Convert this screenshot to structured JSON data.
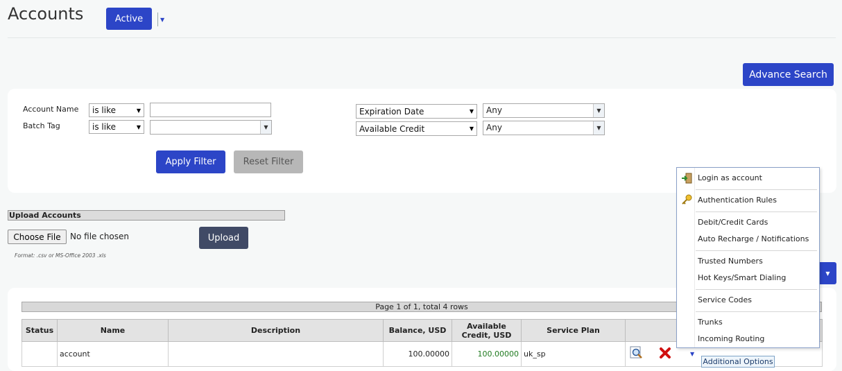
{
  "header": {
    "title": "Accounts",
    "status_button": "Active",
    "caret_glyph": "▼",
    "advance_search": "Advance Search"
  },
  "filter": {
    "account_name_label": "Account Name",
    "batch_tag_label": "Batch Tag",
    "account_name_op": "is like",
    "batch_tag_op": "is like",
    "account_name_value": "",
    "batch_tag_value": "",
    "expiration_field": "Expiration Date",
    "expiration_value": "Any",
    "credit_field": "Available Credit",
    "credit_value": "Any",
    "apply": "Apply Filter",
    "reset": "Reset Filter"
  },
  "upload": {
    "header": "Upload Accounts",
    "choose_file": "Choose File",
    "no_file": "No file chosen",
    "upload": "Upload",
    "format_note": "Format: .csv or MS-Office 2003 .xls"
  },
  "table": {
    "pager": "Page 1 of 1, total 4 rows",
    "columns": [
      "Status",
      "Name",
      "Description",
      "Balance, USD",
      "Available Credit, USD",
      "Service Plan",
      ""
    ],
    "rows": [
      {
        "status": "",
        "name": "account",
        "description": "",
        "balance": "100.00000",
        "available_credit": "100.00000",
        "service_plan": "uk_sp"
      }
    ],
    "additional_options": "Additional Options"
  },
  "context_menu": {
    "items": [
      {
        "label": "Login as account",
        "icon": "login-icon"
      },
      {
        "label": "Authentication Rules",
        "icon": "key-icon"
      },
      {
        "label": "Debit/Credit Cards",
        "icon": ""
      },
      {
        "label": "Auto Recharge / Notifications",
        "icon": ""
      },
      {
        "label": "Trusted Numbers",
        "icon": ""
      },
      {
        "label": "Hot Keys/Smart Dialing",
        "icon": ""
      },
      {
        "label": "Service Codes",
        "icon": ""
      },
      {
        "label": "Trunks",
        "icon": ""
      },
      {
        "label": "Incoming Routing",
        "icon": ""
      }
    ]
  },
  "colors": {
    "primary": "#2c45c7",
    "upload_button": "#404a66",
    "reset_button": "#b7b7b7",
    "credit_text": "#1f7a1f",
    "delete_icon": "#d01010"
  }
}
